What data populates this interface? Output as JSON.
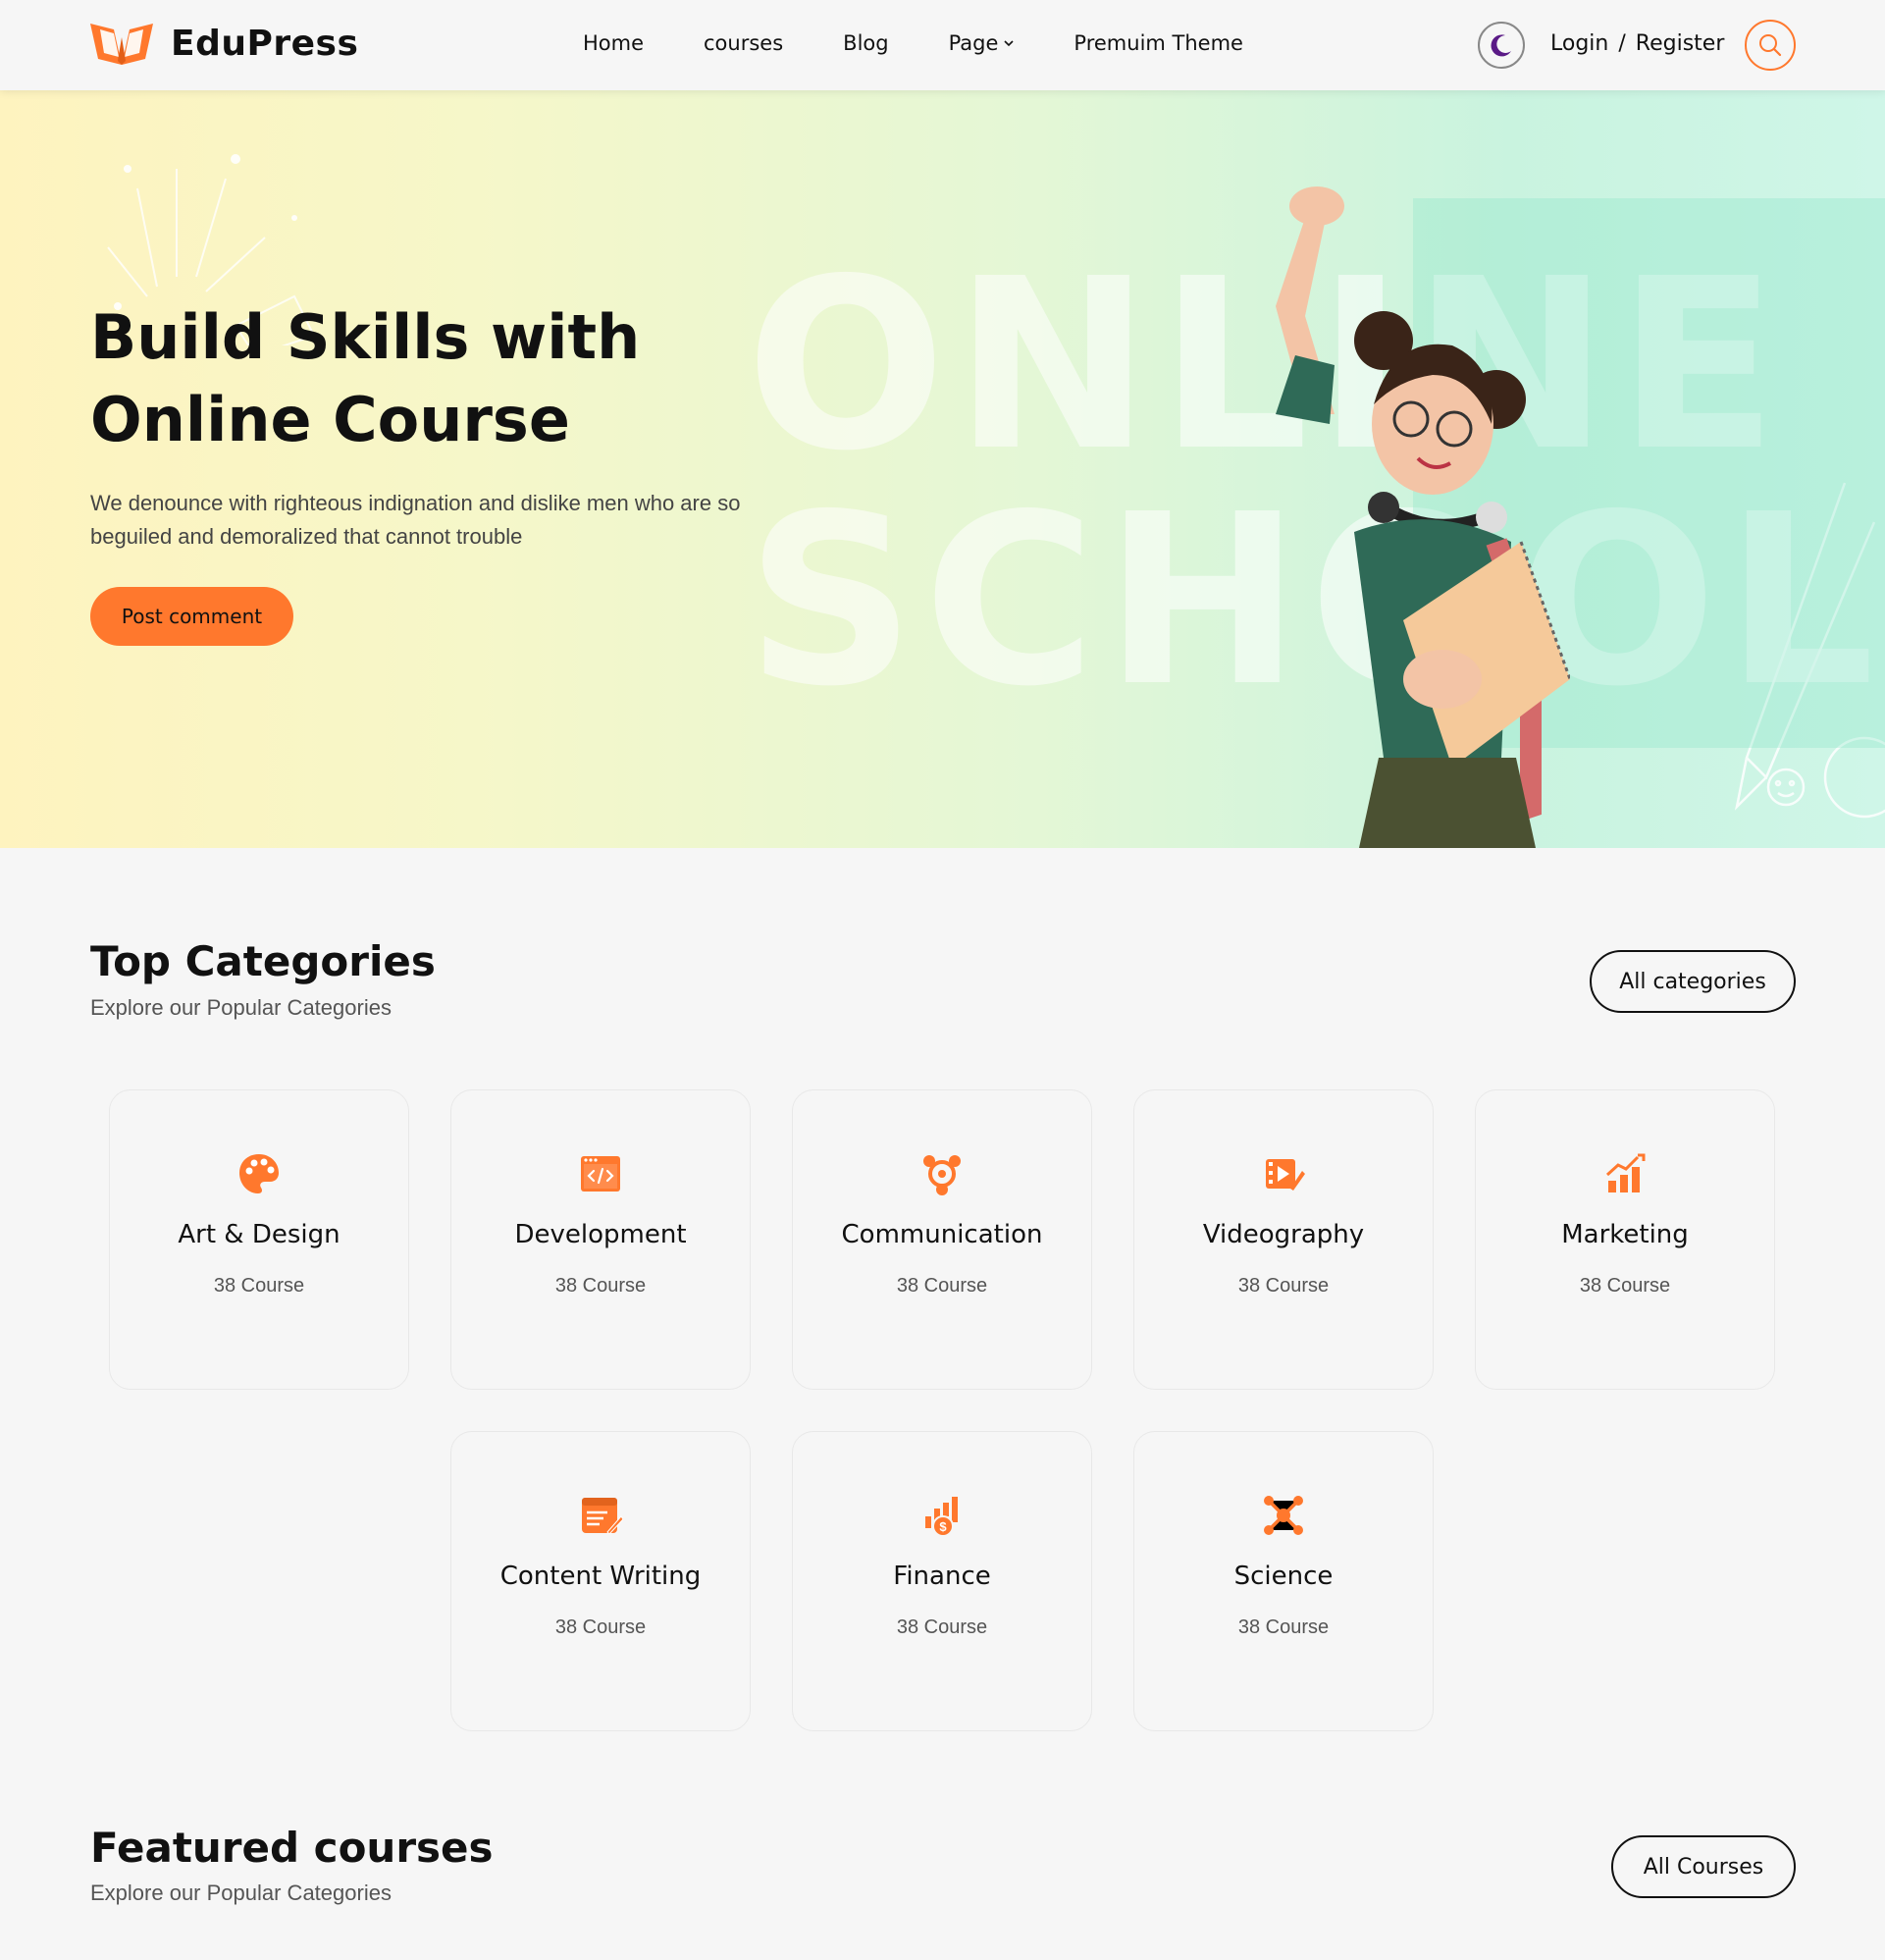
{
  "brand": {
    "name": "EduPress",
    "accent": "#ff782d",
    "moon_color": "#5a1a86"
  },
  "nav": {
    "items": [
      {
        "label": "Home"
      },
      {
        "label": "courses"
      },
      {
        "label": "Blog"
      },
      {
        "label": "Page",
        "has_dropdown": true,
        "icon": "chevron-down-icon"
      },
      {
        "label": "Premuim Theme"
      }
    ]
  },
  "header": {
    "theme_icon": "moon-icon",
    "login_label": "Login",
    "separator": "/",
    "register_label": "Register",
    "search_icon": "search-icon"
  },
  "hero": {
    "title_line1": "Build Skills with",
    "title_line2": "Online Course",
    "description": "We denounce with righteous indignation and dislike men who are so beguiled and demoralized that cannot trouble",
    "cta_label": "Post comment",
    "background_text_line1": "ONLINE",
    "background_text_line2": "SCHOOL"
  },
  "categories": {
    "title": "Top Categories",
    "subtitle": "Explore our Popular Categories",
    "all_button": "All categories",
    "items": [
      {
        "name": "Art & Design",
        "count": "38 Course",
        "icon": "palette-icon"
      },
      {
        "name": "Development",
        "count": "38 Course",
        "icon": "code-window-icon"
      },
      {
        "name": "Communication",
        "count": "38 Course",
        "icon": "team-communication-icon"
      },
      {
        "name": "Videography",
        "count": "38 Course",
        "icon": "video-editing-icon"
      },
      {
        "name": "Marketing",
        "count": "38 Course",
        "icon": "growth-chart-icon"
      },
      {
        "name": "Content Writing",
        "count": "38 Course",
        "icon": "content-writing-icon"
      },
      {
        "name": "Finance",
        "count": "38 Course",
        "icon": "finance-chart-icon"
      },
      {
        "name": "Science",
        "count": "38 Course",
        "icon": "molecule-icon"
      }
    ]
  },
  "featured": {
    "title": "Featured courses",
    "subtitle": "Explore our Popular Categories",
    "all_button": "All Courses"
  }
}
